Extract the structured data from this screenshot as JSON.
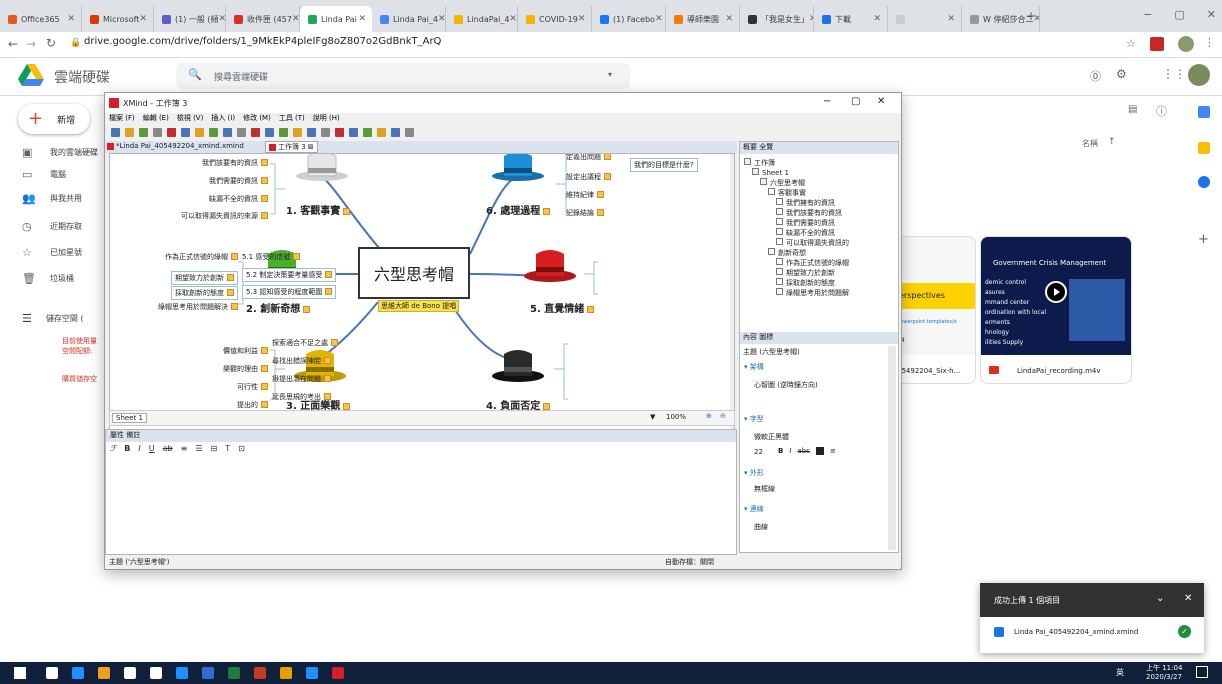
{
  "browser": {
    "tabs": [
      {
        "label": "Office365",
        "color": "#e35b1e"
      },
      {
        "label": "Microsoft",
        "color": "#d83b01"
      },
      {
        "label": "(1) 一般 (頻",
        "color": "#5b5fc7"
      },
      {
        "label": "收件匣 (457",
        "color": "#d93025"
      },
      {
        "label": "Linda Pai",
        "color": "#1fa463"
      },
      {
        "label": "Linda Pai_4",
        "color": "#4285f4"
      },
      {
        "label": "LindaPai_4",
        "color": "#f4b400"
      },
      {
        "label": "COVID-19",
        "color": "#f4b400"
      },
      {
        "label": "(1) Facebo",
        "color": "#1877f2"
      },
      {
        "label": "導師樂園",
        "color": "#f57c00"
      },
      {
        "label": "「我是女生」",
        "color": "#333333"
      },
      {
        "label": "下載",
        "color": "#1a73e8"
      },
      {
        "label": "",
        "color": "#cccccc"
      },
      {
        "label": "W 停紹莎合二",
        "color": "#999999"
      }
    ],
    "new_tab": "+",
    "url": "drive.google.com/drive/folders/1_9MkEkP4pleIFg8oZ807o2GdBnkT_ArQ",
    "win_min": "−",
    "win_max": "▢",
    "win_close": "✕"
  },
  "drive": {
    "app_name": "雲端硬碟",
    "search_placeholder": "搜尋雲端硬碟",
    "new_label": "新增",
    "sidebar": [
      {
        "label": "我的雲端硬碟",
        "icon": "drive-icon"
      },
      {
        "label": "電腦",
        "icon": "computer-icon"
      },
      {
        "label": "與我共用",
        "icon": "shared-icon"
      },
      {
        "label": "近期存取",
        "icon": "clock-icon"
      },
      {
        "label": "已加星號",
        "icon": "star-icon"
      },
      {
        "label": "垃圾桶",
        "icon": "trash-icon"
      }
    ],
    "storage_label": "儲存空間 (",
    "storage_note_1": "目前使用量",
    "storage_note_2": "空間配額:",
    "buy_storage": "購買儲存空",
    "sort_label": "名稱",
    "sort_arrow": "↑",
    "cards": [
      {
        "name": "05492204_Six-h...",
        "preview_text": "erspectives",
        "preview_small": "powerpoint.templates/o",
        "preview_num": "04"
      },
      {
        "name": "LindaPai_recording.m4v",
        "preview_title": "Government Crisis Management",
        "preview_lines": [
          "demic control",
          "asures",
          "mmand center",
          "ordination with local",
          "erments",
          "hnology",
          "ilities Supply"
        ]
      }
    ],
    "toast_title": "成功上傳 1 個項目",
    "toast_file": "Linda Pai_405492204_xmind.xmind"
  },
  "xmind": {
    "title": "XMind - 工作簿 3",
    "menu": [
      "檔案 (F)",
      "編輯 (E)",
      "檢視 (V)",
      "插入 (I)",
      "修改 (M)",
      "工具 (T)",
      "說明 (H)"
    ],
    "tab1": "*Linda Pai_405492204_xmind.xmind",
    "tab2": "工作簿 3",
    "center": "六型思考帽",
    "center_sub": "思維大師 de Bono 提唱",
    "topics": {
      "t1": "1. 客觀事實",
      "t2": "2. 創新奇想",
      "t3": "3. 正面樂觀",
      "t4": "4. 負面否定",
      "t5": "5. 直覺情緒",
      "t6": "6. 處理過程"
    },
    "t1_items": [
      "我們該要有的資訊",
      "我們需要的資訊",
      "缺漏不全的資訊",
      "可以取得漏失資訊的來源"
    ],
    "t2_items": [
      "作為正式信號的綠帽",
      "期望致力於創新",
      "採取創新的態度",
      "綠帽思考用於問題解決"
    ],
    "t3_items": [
      "價值和利益",
      "樂觀的理由",
      "可行性",
      "提出的"
    ],
    "t4_items": [
      "探索適合不足之處",
      "尋找出錯誤陳腔",
      "揪提出潛在問題",
      "延長思規的考出"
    ],
    "t5_items": [
      "5.1 感受的信號",
      "5.2 制定決策要考量感受",
      "5.3 認知感受的程度範圍"
    ],
    "t6_items": [
      "定義出問題",
      "我們的目標是什麼?",
      "設定出議程",
      "維持紀律",
      "記錄結論"
    ],
    "sheet_tab": "Sheet 1",
    "zoom": "100%",
    "notes_tabs": "屬性  備註",
    "status_left": "主題 ('六型思考帽')",
    "status_right": "自動存檔：關閉",
    "outline_title": "概要",
    "outline_tab2": "全覽",
    "tree": [
      "工作簿",
      "Sheet 1",
      "六型思考帽",
      "客觀事實",
      "我們擁有的資訊",
      "我們該要有的資訊",
      "我們需要的資訊",
      "缺漏不全的資訊",
      "可以取得漏失資訊的",
      "創新奇想",
      "作為正式信號的綠帽",
      "期望致力於創新",
      "採取創新的態度",
      "綠帽思考用於問題解"
    ],
    "props_tabs": "內容  圖標",
    "props_subject": "主題 (六型思考帽)",
    "sec_structure": "架構",
    "structure_value": "心智圖 (逆時鐘方向)",
    "sec_text": "字型",
    "font_name": "微軟正黑體",
    "font_size": "22",
    "sec_shape": "外形",
    "shape_value": "無框線",
    "sec_line": "連線",
    "line_value": "曲線"
  },
  "taskbar": {
    "clock_time": "上午 11:04",
    "clock_date": "2020/3/27",
    "ime": "英"
  },
  "colors": {
    "white_hat": "#e6e6e6",
    "green_hat": "#4caf2a",
    "yellow_hat": "#e0b400",
    "black_hat": "#2a2a2a",
    "red_hat": "#d81e1e",
    "blue_hat": "#1e8fd6"
  }
}
